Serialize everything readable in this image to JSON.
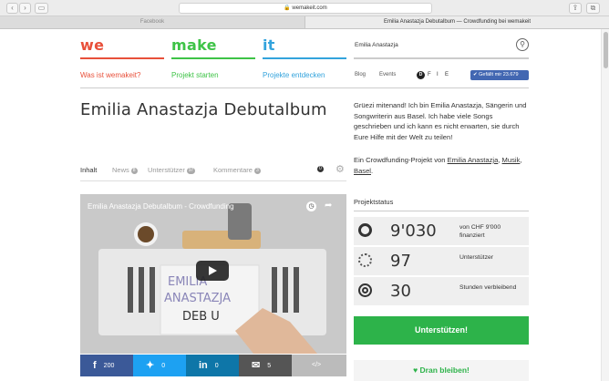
{
  "browser": {
    "url": "wemakeit.com",
    "tabs": [
      {
        "label": "Facebook",
        "active": false
      },
      {
        "label": "Emilia Anastazja Debutalbum — Crowdfunding bei wemakeit",
        "active": true
      }
    ]
  },
  "site": {
    "logo": {
      "we": "we",
      "make": "make",
      "it": "it"
    },
    "colors": {
      "red": "#e8503a",
      "green": "#3ec347",
      "blue": "#33a3dc",
      "facebook": "#4267b2",
      "cta": "#2db34a"
    },
    "nav": {
      "what": "Was ist wemakeit?",
      "start": "Projekt starten",
      "discover": "Projekte entdecken"
    },
    "search_label": "Emilia Anastazja",
    "sub": {
      "blog": "Blog",
      "events": "Events"
    },
    "languages": {
      "active": "D",
      "f": "F",
      "i": "I",
      "e": "E"
    },
    "fb_like": "Gefällt mir 23.679"
  },
  "project": {
    "title": "Emilia Anastazja Debutalbum",
    "intro": "Grüezi mitenand! Ich bin Emilia Anastazja, Sängerin und Songwriterin aus Basel. Ich habe viele Songs geschrieben und ich kann es nicht erwarten, sie durch Eure Hilfe mit der Welt zu teilen!",
    "by_prefix": "Ein Crowdfunding-Projekt von",
    "by_name": "Emilia Anastazja",
    "tag1": "Musik",
    "tag2": "Basel",
    "tabs": [
      {
        "label": "Inhalt",
        "badge": ""
      },
      {
        "label": "News",
        "badge": "8"
      },
      {
        "label": "Unterstützer",
        "badge": "97"
      },
      {
        "label": "Kommentare",
        "badge": "3"
      }
    ],
    "comment_counter": "0",
    "video_title": "Emilia Anastazja Debutalbum - Crowdfunding",
    "share": {
      "facebook": "200",
      "twitter": "0",
      "linkedin": "0",
      "email": "5",
      "embed": "</>"
    }
  },
  "status": {
    "heading": "Projektstatus",
    "funded_value": "9'030",
    "funded_label": "von CHF 9'000 finanziert",
    "backers_value": "97",
    "backers_label": "Unterstützer",
    "hours_value": "30",
    "hours_label": "Stunden verbleibend",
    "support_button": "Unterstützen!",
    "stay_button": "Dran bleiben!"
  }
}
